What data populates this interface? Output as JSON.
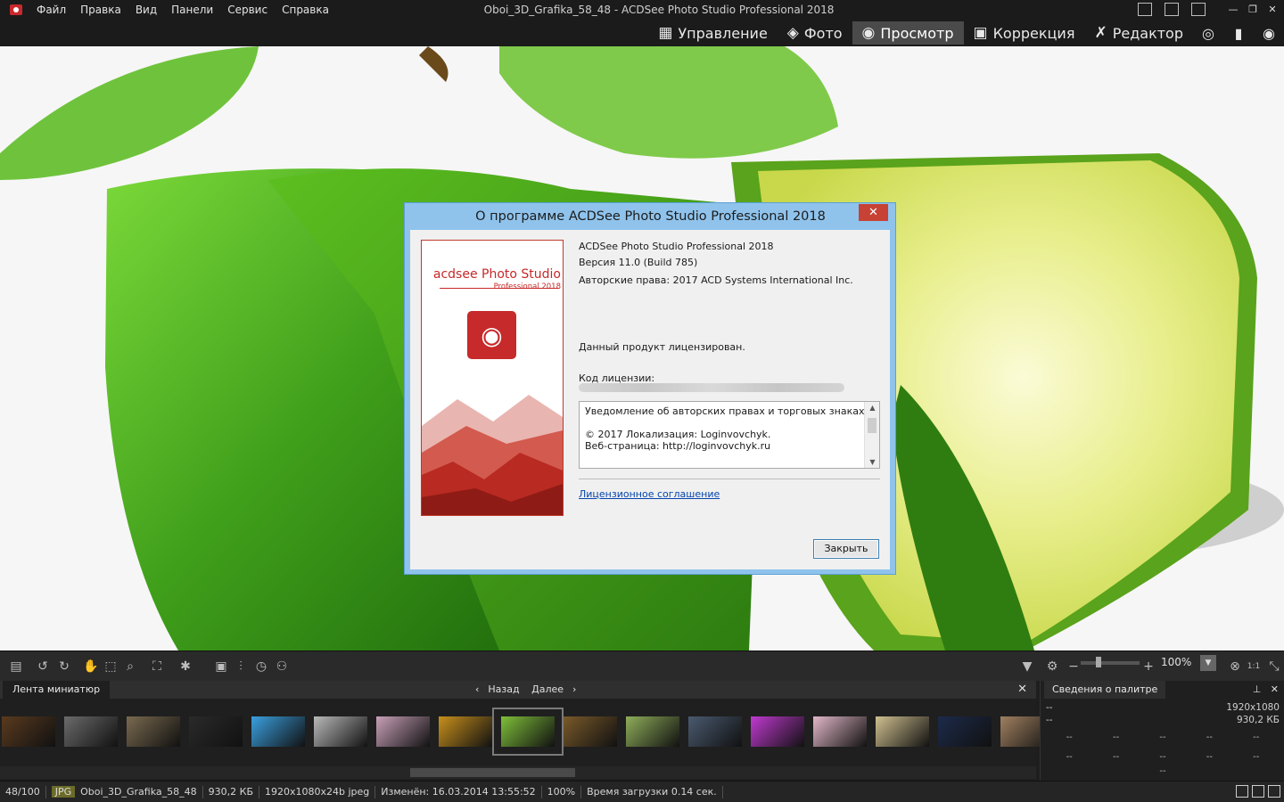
{
  "app": {
    "window_title": "Oboi_3D_Grafika_58_48 - ACDSee Photo Studio Professional 2018",
    "menu": [
      "Файл",
      "Правка",
      "Вид",
      "Панели",
      "Сервис",
      "Справка"
    ]
  },
  "modes": {
    "manage": "Управление",
    "photo": "Фото",
    "view": "Просмотр",
    "develop": "Коррекция",
    "edit": "Редактор",
    "icons": [
      "365-icon",
      "dashboard-icon",
      "eye-icon"
    ]
  },
  "dialog": {
    "title": "О программе ACDSee Photo Studio Professional 2018",
    "close_glyph": "✕",
    "logo": {
      "brand": "acdsee Photo Studio",
      "edition": "Professional 2018"
    },
    "product": "ACDSee Photo Studio Professional 2018",
    "version": "Версия 11.0 (Build 785)",
    "copyright": "Авторские права: 2017 ACD Systems International Inc.",
    "licensed": "Данный продукт лицензирован.",
    "license_label": "Код лицензии:",
    "notice": {
      "heading": "Уведомление об авторских правах и торговых знаках:",
      "line1": "© 2017 Локализация: Loginvovchyk.",
      "line2": "Веб-страница: http://loginvovchyk.ru"
    },
    "license_link": "Лицензионное соглашение",
    "close_button": "Закрыть"
  },
  "toolbar": {
    "zoom_value": "100%",
    "ratio_label": "1:1"
  },
  "filmstrip": {
    "tab": "Лента миниатюр",
    "back": "Назад",
    "next": "Далее",
    "close": "✕",
    "thumb_colors": [
      "#5a3a1e",
      "#6b6b6b",
      "#7a6a50",
      "#2a2a2a",
      "#3aa0e0",
      "#b9b9b9",
      "#c8a0b8",
      "#c8901c",
      "#7fbf3a",
      "#7a5a2a",
      "#8fae5a",
      "#4a5a70",
      "#c03ad0",
      "#e2b8c8",
      "#d0c090",
      "#1c2a4a",
      "#a08060"
    ]
  },
  "palette": {
    "tab": "Сведения о палитре",
    "dims": "1920x1080",
    "size": "930,2 КБ",
    "dash": "--"
  },
  "status": {
    "index": "48/100",
    "format": "JPG",
    "filename": "Oboi_3D_Grafika_58_48",
    "filesize": "930,2 КБ",
    "dims": "1920x1080x24b jpeg",
    "modified": "Изменён: 16.03.2014 13:55:52",
    "zoom": "100%",
    "load_time": "Время загрузки 0.14 сек."
  }
}
